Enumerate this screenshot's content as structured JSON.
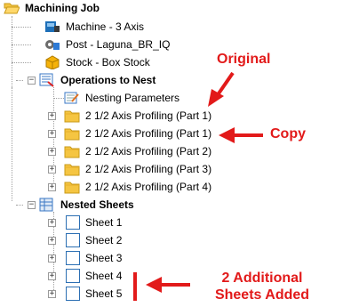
{
  "tree": {
    "root": {
      "label": "Machining Job",
      "icon": "folder-open-icon"
    },
    "machine": {
      "label": "Machine - 3 Axis",
      "icon": "machine-icon"
    },
    "post": {
      "label": "Post - Laguna_BR_IQ",
      "icon": "post-icon"
    },
    "stock": {
      "label": "Stock - Box Stock",
      "icon": "stock-box-icon"
    },
    "operations": {
      "label": "Operations to Nest",
      "icon": "operations-icon",
      "items": [
        {
          "label": "Nesting Parameters",
          "icon": "nesting-parameters-icon"
        },
        {
          "label": "2 1/2 Axis Profiling (Part 1)",
          "icon": "folder-icon"
        },
        {
          "label": "2 1/2 Axis Profiling (Part 1)",
          "icon": "folder-icon"
        },
        {
          "label": "2 1/2 Axis Profiling (Part 2)",
          "icon": "folder-icon"
        },
        {
          "label": "2 1/2 Axis Profiling (Part 3)",
          "icon": "folder-icon"
        },
        {
          "label": "2 1/2 Axis Profiling (Part 4)",
          "icon": "folder-icon"
        }
      ]
    },
    "nested_sheets": {
      "label": "Nested Sheets",
      "icon": "nested-sheets-icon",
      "items": [
        {
          "label": "Sheet 1",
          "icon": "sheet-icon"
        },
        {
          "label": "Sheet 2",
          "icon": "sheet-icon"
        },
        {
          "label": "Sheet 3",
          "icon": "sheet-icon"
        },
        {
          "label": "Sheet 4",
          "icon": "sheet-icon"
        },
        {
          "label": "Sheet 5",
          "icon": "sheet-icon"
        }
      ]
    }
  },
  "annotations": {
    "original": "Original",
    "copy": "Copy",
    "sheets_added_line1": "2 Additional",
    "sheets_added_line2": "Sheets Added",
    "color": "#e21a1a"
  },
  "colors": {
    "folder": "#f5c542",
    "folder_edge": "#c99a18",
    "sheet_border": "#2c6fb3",
    "tree_line": "#a0a0a0"
  }
}
